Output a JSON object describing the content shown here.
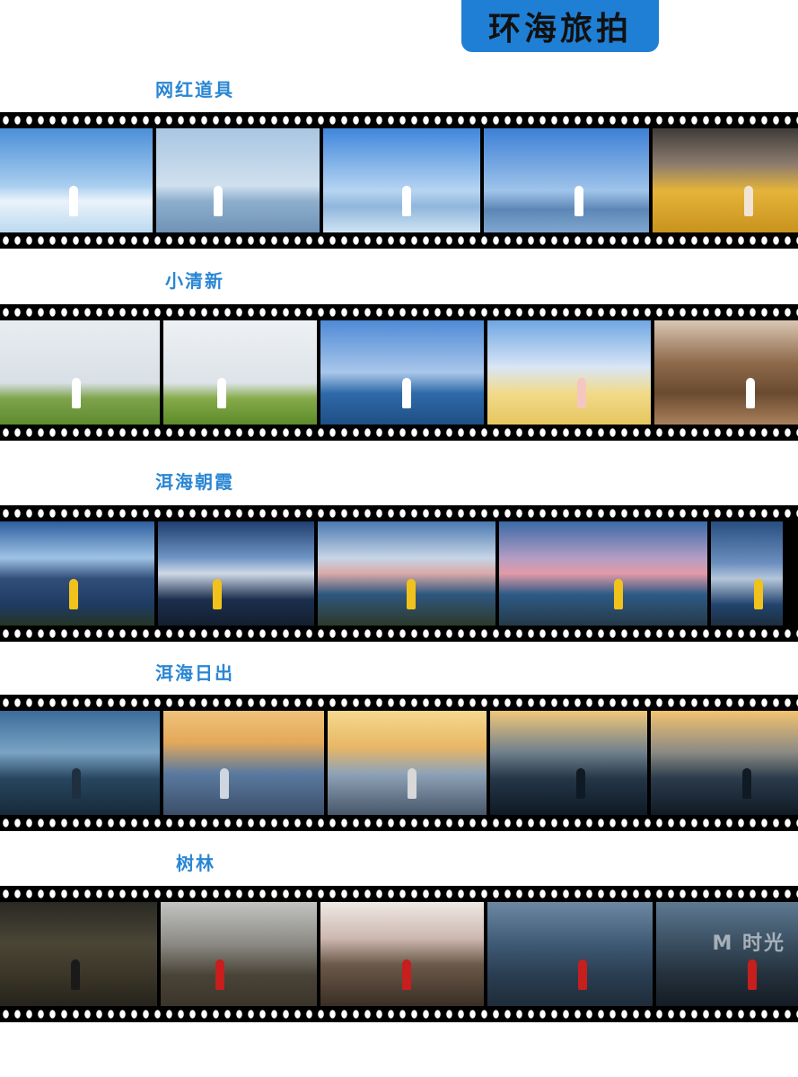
{
  "header": {
    "title": "环海旅拍"
  },
  "sections": [
    {
      "label": "网红道具",
      "frames": [
        {
          "w": 170,
          "bg": "linear-gradient(#4b8fd8 0%, #a8cdef 55%, #eaf3fb 70%, #bcd9ef 100%)",
          "fig": "#ffffff"
        },
        {
          "w": 182,
          "bg": "linear-gradient(#a9c6e2 0%, #cfe0ee 55%, #8eaecd 70%, #6f93b6 100%)",
          "fig": "#ffffff"
        },
        {
          "w": 175,
          "bg": "linear-gradient(#3f86dc 0%, #b7d5f2 60%, #8fb6dc 75%, #cfe3f3 100%)",
          "fig": "#ffffff"
        },
        {
          "w": 184,
          "bg": "linear-gradient(#3d7fd6 0%, #9fc4ea 60%, #5c86b6 78%, #7fa7cf 100%)",
          "fig": "#ffffff"
        },
        {
          "w": 170,
          "bg": "linear-gradient(#3f3b3a 0%, #8e7d6e 35%, #e5b43a 60%, #c8931e 100%)",
          "fig": "#f2e4d5"
        }
      ]
    },
    {
      "label": "小清新",
      "frames": [
        {
          "w": 178,
          "bg": "linear-gradient(#e9edf1 0%, #d8dfe6 60%, #7ea44b 75%, #5f8b2f 100%)",
          "fig": "#ffffff"
        },
        {
          "w": 171,
          "bg": "linear-gradient(#eef1f4 0%, #dde3e8 60%, #85ab4a 75%, #5d8a2a 100%)",
          "fig": "#ffffff"
        },
        {
          "w": 182,
          "bg": "linear-gradient(#4e8ad6 0%, #a9c7ea 50%, #2f6aa8 70%, #1f4f86 100%)",
          "fig": "#ffffff"
        },
        {
          "w": 182,
          "bg": "linear-gradient(#6fa6e3 0%, #d9e6f5 45%, #f1da8a 70%, #e6c65e 100%)",
          "fig": "#f4c7c0"
        },
        {
          "w": 170,
          "bg": "linear-gradient(#d9c7b4 0%, #8f6b4b 40%, #6a4a30 70%, #a9815b 100%)",
          "fig": "#ffffff"
        }
      ]
    },
    {
      "label": "洱海朝霞",
      "frames": [
        {
          "w": 172,
          "bg": "linear-gradient(#2d5e9e 0%, #9fc3e6 35%, #314e7a 55%, #1e3b63 80%, #263524 100%)",
          "fig": "#f1c21b"
        },
        {
          "w": 174,
          "bg": "linear-gradient(#1e3e6e 0%, #6f95c4 35%, #cfd8e6 50%, #1b2f4f 75%, #141f2e 100%)",
          "fig": "#f1c21b"
        },
        {
          "w": 198,
          "bg": "linear-gradient(#4a79b0 0%, #c6d5e6 35%, #d9a9a8 50%, #2e577f 70%, #2d3a2a 100%)",
          "fig": "#f1c21b"
        },
        {
          "w": 232,
          "bg": "linear-gradient(#3a6aa6 0%, #b39dc4 35%, #e39aa8 50%, #2d5a86 70%, #263a48 100%)",
          "fig": "#f1c21b"
        },
        {
          "w": 80,
          "bg": "linear-gradient(#274e80 0%, #6b8fbe 40%, #b5c6da 55%, #22446e 80%, #1d2e3e 100%)",
          "fig": "#f1c21b"
        }
      ]
    },
    {
      "label": "洱海日出",
      "frames": [
        {
          "w": 178,
          "bg": "linear-gradient(#3a6c9a 0%, #7aa3c4 40%, #28465f 65%, #172a3a 100%)",
          "fig": "#1f2f3f"
        },
        {
          "w": 179,
          "bg": "linear-gradient(#f0c27a 0%, #e4a95a 30%, #5b7aa0 60%, #3b4f68 100%)",
          "fig": "#cfd6df"
        },
        {
          "w": 177,
          "bg": "linear-gradient(#f5d98f 0%, #e7b766 35%, #8fa3b8 60%, #48576a 100%)",
          "fig": "#d8d8d8"
        },
        {
          "w": 175,
          "bg": "linear-gradient(#f1c879 0%, #6f7f8c 40%, #243648 65%, #0f1a24 100%)",
          "fig": "#0f1a24"
        },
        {
          "w": 170,
          "bg": "linear-gradient(#f3c36f 0%, #8a8a84 40%, #2b3b4b 65%, #101a24 100%)",
          "fig": "#101a24"
        }
      ]
    },
    {
      "label": "树林",
      "frames": [
        {
          "w": 175,
          "bg": "linear-gradient(#2a2a24 0%, #4a4636 40%, #3b3628 70%, #25231c 100%)",
          "fig": "#1a1a1a"
        },
        {
          "w": 174,
          "bg": "linear-gradient(#c2c4c2 0%, #8c8a84 40%, #4a4438 70%, #3a342a 100%)",
          "fig": "#c71e1e"
        },
        {
          "w": 182,
          "bg": "linear-gradient(#efe8e4 0%, #cdb8b0 35%, #6b5a4a 60%, #3a2e24 100%)",
          "fig": "#c71e1e"
        },
        {
          "w": 184,
          "bg": "linear-gradient(#6d88a2 0%, #3e5a74 40%, #2a3e52 70%, #1e2c3a 100%)",
          "fig": "#c71e1e"
        },
        {
          "w": 170,
          "bg": "linear-gradient(#5d7a92 0%, #3a4e60 40%, #24313c 70%, #141c24 100%)",
          "fig": "#c71e1e"
        }
      ]
    }
  ],
  "watermark": "M 时光"
}
